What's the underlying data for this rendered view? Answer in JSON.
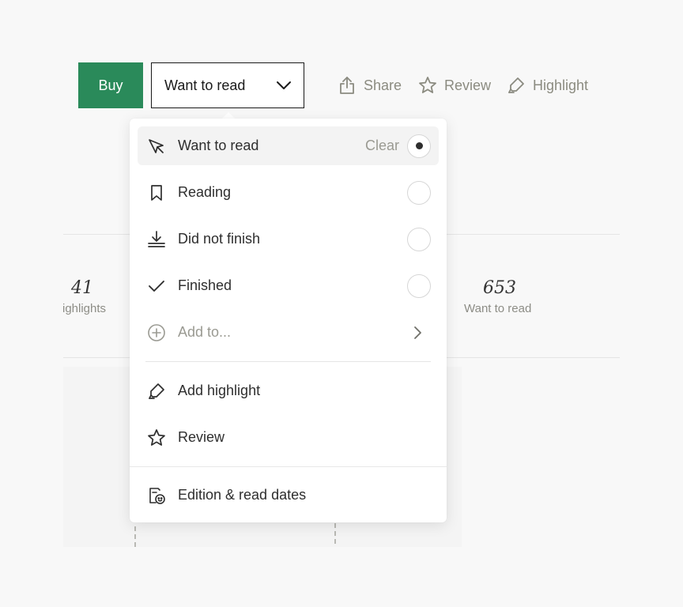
{
  "toolbar": {
    "buy_label": "Buy",
    "status_label": "Want to read",
    "share_label": "Share",
    "review_label": "Review",
    "highlight_label": "Highlight"
  },
  "stats": {
    "left_number": "41",
    "left_label": "ighlights",
    "right_number": "653",
    "right_label": "Want to read"
  },
  "menu": {
    "clear_label": "Clear",
    "items": [
      {
        "label": "Want to read",
        "icon": "pin-icon",
        "selected": true
      },
      {
        "label": "Reading",
        "icon": "bookmark-icon",
        "selected": false
      },
      {
        "label": "Did not finish",
        "icon": "download-tray-icon",
        "selected": false
      },
      {
        "label": "Finished",
        "icon": "checkmark-icon",
        "selected": false
      },
      {
        "label": "Add to...",
        "icon": "plus-circle-icon"
      },
      {
        "label": "Add highlight",
        "icon": "highlighter-icon"
      },
      {
        "label": "Review",
        "icon": "star-icon"
      },
      {
        "label": "Edition & read dates",
        "icon": "edition-icon"
      }
    ]
  },
  "colors": {
    "accent_green": "#2a8a5a",
    "muted_text": "#9a9a92",
    "background": "#f8f8f8"
  }
}
